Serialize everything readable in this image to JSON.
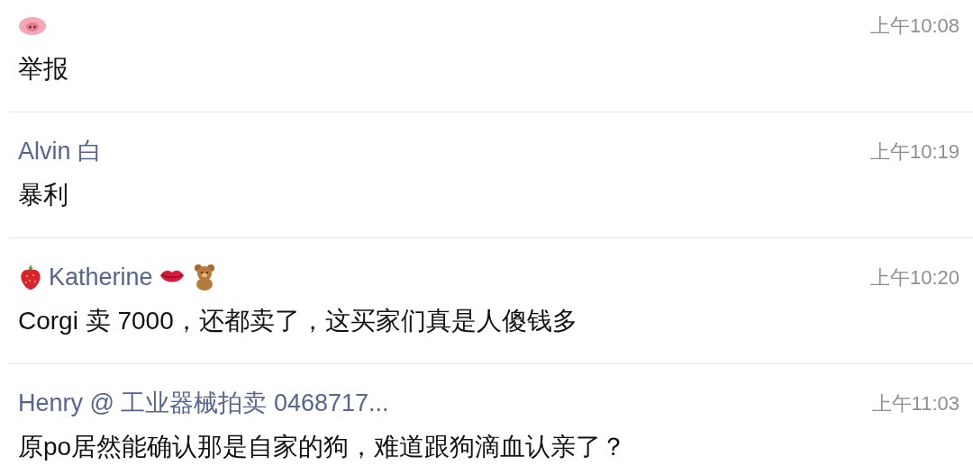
{
  "messages": [
    {
      "name_parts": [
        {
          "kind": "pig"
        }
      ],
      "time": "上午10:08",
      "text": "举报"
    },
    {
      "name_parts": [
        {
          "kind": "text",
          "text": "Alvin 白"
        }
      ],
      "time": "上午10:19",
      "text": "暴利"
    },
    {
      "name_parts": [
        {
          "kind": "strawberry"
        },
        {
          "kind": "text",
          "text": "Katherine"
        },
        {
          "kind": "lips"
        },
        {
          "kind": "bear"
        }
      ],
      "time": "上午10:20",
      "text": "Corgi 卖 7000，还都卖了，这买家们真是人傻钱多"
    },
    {
      "name_parts": [
        {
          "kind": "text",
          "text": "Henry @ 工业器械拍卖 0468717..."
        }
      ],
      "time": "上午11:03",
      "text": "原po居然能确认那是自家的狗，难道跟狗滴血认亲了？"
    }
  ]
}
